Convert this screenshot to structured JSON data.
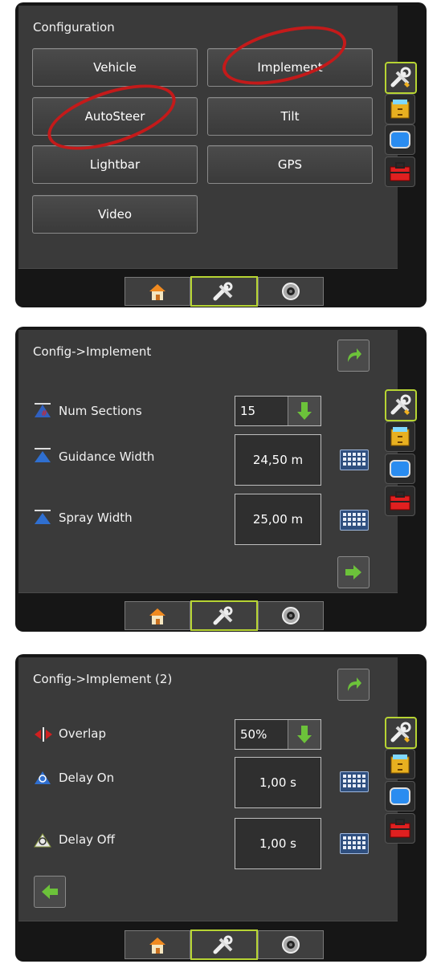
{
  "colors": {
    "accent": "#b7d433",
    "highlight_red": "#c41a1a",
    "panel_bg": "#3a3a3a"
  },
  "screen1": {
    "title": "Configuration",
    "buttons": [
      "Vehicle",
      "Implement",
      "AutoSteer",
      "Tilt",
      "Lightbar",
      "GPS",
      "Video"
    ]
  },
  "screen2": {
    "title": "Config->Implement",
    "num_sections": {
      "label": "Num Sections",
      "value": "15"
    },
    "guidance_width": {
      "label": "Guidance Width",
      "value": "24,50 m"
    },
    "spray_width": {
      "label": "Spray Width",
      "value": "25,00 m"
    }
  },
  "screen3": {
    "title": "Config->Implement (2)",
    "overlap": {
      "label": "Overlap",
      "value": "50%"
    },
    "delay_on": {
      "label": "Delay On",
      "value": "1,00 s"
    },
    "delay_off": {
      "label": "Delay Off",
      "value": "1,00 s"
    }
  },
  "tools": [
    "tools-icon",
    "file-cabinet-icon",
    "display-icon",
    "toolbox-icon"
  ],
  "bottom_tabs": [
    "home-icon",
    "tools-icon",
    "camera-icon"
  ]
}
